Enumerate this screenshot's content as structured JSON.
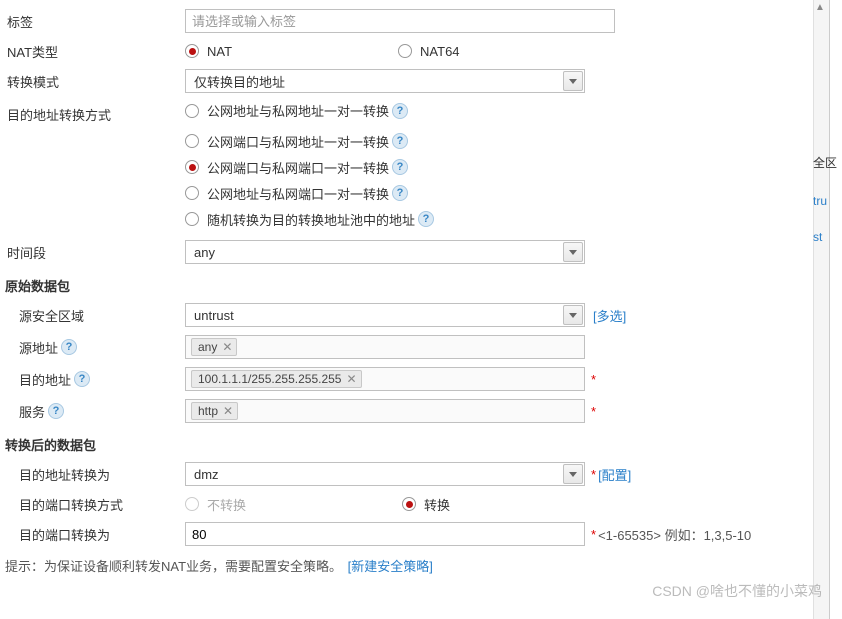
{
  "labels": {
    "tag": "标签",
    "nat_type": "NAT类型",
    "convert_mode": "转换模式",
    "dest_convert_method": "目的地址转换方式",
    "time_period": "时间段",
    "original_packet": "原始数据包",
    "src_zone": "源安全区域",
    "src_addr": "源地址",
    "dest_addr": "目的地址",
    "service": "服务",
    "converted_packet": "转换后的数据包",
    "dest_addr_convert_to": "目的地址转换为",
    "dest_port_convert_method": "目的端口转换方式",
    "dest_port_convert_to": "目的端口转换为"
  },
  "placeholders": {
    "tag": "请选择或输入标签"
  },
  "nat_type": {
    "options": [
      "NAT",
      "NAT64"
    ],
    "selected": "NAT"
  },
  "convert_mode": {
    "value": "仅转换目的地址"
  },
  "dest_method_options": [
    "公网地址与私网地址一对一转换",
    "公网端口与私网地址一对一转换",
    "公网端口与私网端口一对一转换",
    "公网地址与私网端口一对一转换",
    "随机转换为目的转换地址池中的地址"
  ],
  "dest_method_selected": 2,
  "time_period": {
    "value": "any"
  },
  "src_zone": {
    "value": "untrust"
  },
  "src_addr_tags": [
    "any"
  ],
  "dest_addr_tags": [
    "100.1.1.1/255.255.255.255"
  ],
  "service_tags": [
    "http"
  ],
  "dest_addr_convert_to": {
    "value": "dmz"
  },
  "dest_port_method": {
    "options": [
      "不转换",
      "转换"
    ],
    "selected": "转换"
  },
  "dest_port_value": "80",
  "hints": {
    "port_range": "<1-65535> 例如：1,3,5-10",
    "bottom": "提示：为保证设备顺利转发NAT业务，需要配置安全策略。",
    "new_policy": "[新建安全策略]"
  },
  "links": {
    "multi_select": "[多选]",
    "configure": "[配置]"
  },
  "side_labels": {
    "row1": "全区",
    "row2": "tru",
    "row3": "st"
  },
  "watermark": "CSDN @啥也不懂的小菜鸡"
}
